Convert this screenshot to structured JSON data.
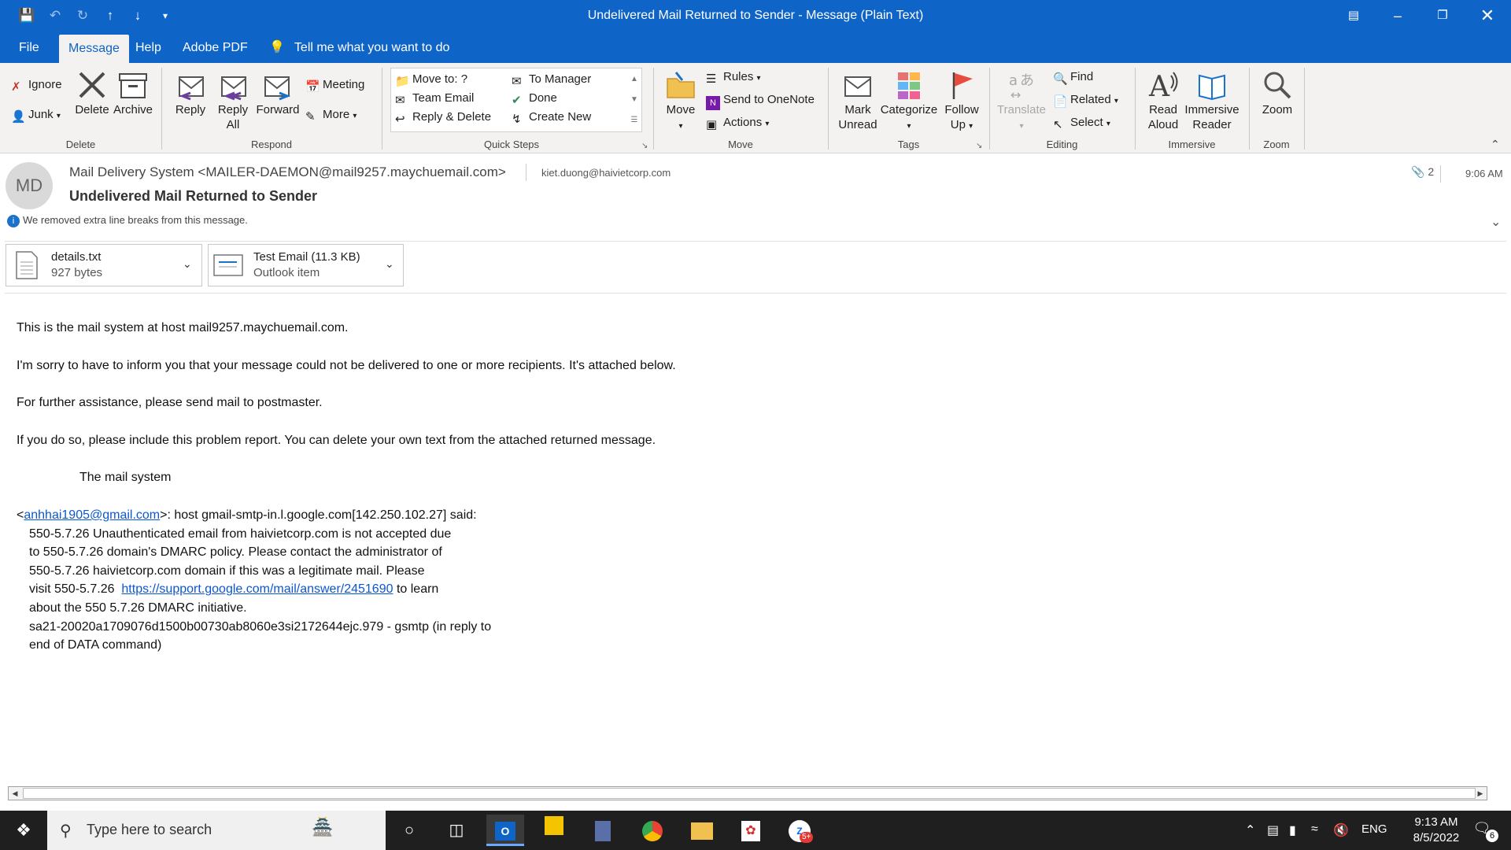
{
  "window": {
    "title": "Undelivered Mail Returned to Sender  -  Message (Plain Text)"
  },
  "tabs": [
    {
      "label": "File"
    },
    {
      "label": "Message"
    },
    {
      "label": "Help"
    },
    {
      "label": "Adobe PDF"
    }
  ],
  "tell_me": "Tell me what you want to do",
  "ribbon": {
    "delete_group": {
      "ignore": "Ignore",
      "junk": "Junk",
      "delete": "Delete",
      "archive": "Archive",
      "label": "Delete"
    },
    "respond_group": {
      "reply": "Reply",
      "reply_all_1": "Reply",
      "reply_all_2": "All",
      "forward": "Forward",
      "meeting": "Meeting",
      "more": "More",
      "label": "Respond"
    },
    "quicksteps": {
      "move_to": "Move to: ?",
      "team_email": "Team Email",
      "reply_delete": "Reply & Delete",
      "to_manager": "To Manager",
      "done": "Done",
      "create_new": "Create New",
      "label": "Quick Steps"
    },
    "move_group": {
      "move": "Move",
      "rules": "Rules",
      "onenote": "Send to OneNote",
      "actions": "Actions",
      "label": "Move"
    },
    "tags_group": {
      "mark_1": "Mark",
      "mark_2": "Unread",
      "categorize": "Categorize",
      "follow_1": "Follow",
      "follow_2": "Up",
      "label": "Tags"
    },
    "editing_group": {
      "translate": "Translate",
      "find": "Find",
      "related": "Related",
      "select": "Select",
      "label": "Editing"
    },
    "immersive_group": {
      "read_1": "Read",
      "read_2": "Aloud",
      "imm_1": "Immersive",
      "imm_2": "Reader",
      "label": "Immersive"
    },
    "zoom_group": {
      "zoom": "Zoom",
      "label": "Zoom"
    }
  },
  "message": {
    "avatar_initials": "MD",
    "from": "Mail Delivery System <MAILER-DAEMON@mail9257.maychuemail.com>",
    "to": "kiet.duong@haivietcorp.com",
    "attachment_count": "2",
    "time": "9:06 AM",
    "subject": "Undelivered Mail Returned to Sender",
    "info": "We removed extra line breaks from this message."
  },
  "attachments": [
    {
      "name": "details.txt",
      "size": "927 bytes"
    },
    {
      "name": "Test Email (11.3 KB)",
      "size": "Outlook item"
    }
  ],
  "body": {
    "p1": "This is the mail system at host mail9257.maychuemail.com.",
    "p2": "I'm sorry to have to inform you that your message could not be delivered to one or more recipients. It's attached below.",
    "p3": "For further assistance, please send mail to postmaster.",
    "p4": "If you do so, please include this problem report. You can delete your own text from the attached returned message.",
    "p5": "The mail system",
    "recipient_open": "<",
    "recipient_email": "anhhai1905@gmail.com",
    "recipient_rest": ">: host gmail-smtp-in.l.google.com[142.250.102.27] said:",
    "l1": "550-5.7.26 Unauthenticated email from haivietcorp.com is not accepted due",
    "l2": "to 550-5.7.26 domain's DMARC policy. Please contact the administrator of",
    "l3": "550-5.7.26 haivietcorp.com domain if this was a legitimate mail. Please",
    "l4_pre": "visit 550-5.7.26  ",
    "l4_link": "https://support.google.com/mail/answer/2451690",
    "l4_post": " to learn",
    "l5": "about the 550 5.7.26 DMARC initiative.",
    "l6": "sa21-20020a1709076d1500b00730ab8060e3si2172644ejc.979 - gsmtp (in reply to",
    "l7": "end of DATA command)"
  },
  "taskbar": {
    "search_placeholder": "Type here to search",
    "time": "9:13 AM",
    "date": "8/5/2022",
    "lang": "ENG",
    "notif_count": "6",
    "badge": "5+"
  },
  "colors": {
    "accent": "#0f64c8",
    "link": "#0b57d0",
    "taskbar": "#1f1f1f"
  }
}
